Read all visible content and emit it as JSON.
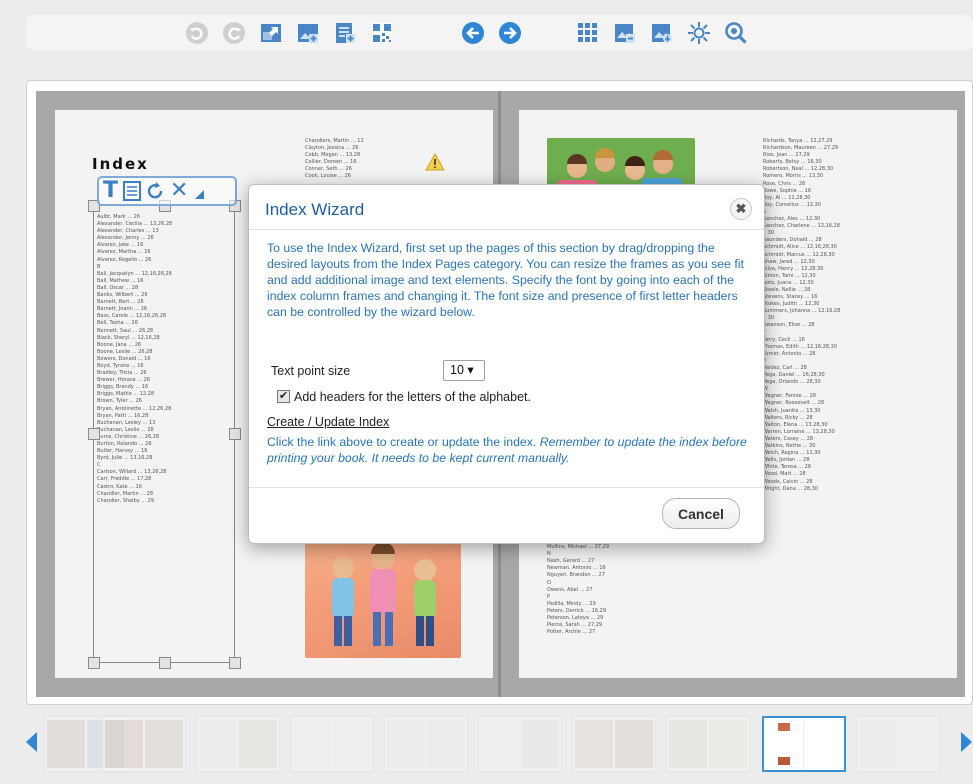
{
  "toolbar": {
    "buttons": [
      {
        "name": "undo-icon",
        "color": "#c8c8c8"
      },
      {
        "name": "redo-icon",
        "color": "#c8c8c8"
      },
      {
        "name": "fullscreen-icon",
        "color": "#4a86c5"
      },
      {
        "name": "add-photo-icon",
        "color": "#4a86c5"
      },
      {
        "name": "add-text-icon",
        "color": "#4a86c5"
      },
      {
        "name": "qr-code-icon",
        "color": "#4a86c5"
      },
      {
        "name": "previous-page-icon",
        "color": "#2e86d6"
      },
      {
        "name": "next-page-icon",
        "color": "#2e86d6"
      },
      {
        "name": "grid-icon",
        "color": "#4a86c5"
      },
      {
        "name": "save-page-icon",
        "color": "#4a86c5"
      },
      {
        "name": "download-page-icon",
        "color": "#4a86c5"
      },
      {
        "name": "brightness-icon",
        "color": "#4a86c5"
      },
      {
        "name": "preview-icon",
        "color": "#4a86c5"
      }
    ]
  },
  "left_page": {
    "title": "Index",
    "col1": "Aulbt, Mark ... 26\nAlexander, Cecilia ... 13,26,28\nAlexander, Charles ... 13\nAlexander, Jenny ... 26\nAlvarez, Jake ... 16\nAlvarez, Martha ... 16\nAlvarez, Rogelio ... 26\nB\nBall, Jacquelyn ... 12,16,26,28\nBall, Mathew ... 16\nBall, Oscar ... 28\nBanks, Wilbert ... 26\nBarnett, Bert ... 26\nBarnett, Joann ... 26\nBass, Carole ... 12,16,26,28\nBell, Tasha ... 26\nBennett, Saul ... 26,28\nBlack, Sheryl ... 12,16,28\nBoone, Jana ... 26\nBoone, Leslie ... 26,28\nBowers, Donald ... 16\nBoyd, Tyrone ... 16\nBradley, Tricia ... 26\nBrewer, Horace ... 26\nBriggs, Brandy ... 16\nBriggs, Mattie ... 12,28\nBrown, Tyler ... 26\nBryan, Antoinette ... 12,26,28\nBryan, Patti ... 16,28\nBuchanan, Lesley ... 13\nBuchanan, Leslie ... 28\nBurns, Christine ... 26,28\nBurton, Rolando ... 26\nButler, Harvey ... 16\nByrd, Julie ... 13,16,28\nC\nCarlson, Willard ... 13,26,28\nCarr, Freddie ... 17,28\nCastro, Kate ... 16\nChandler, Martin ... 28\nChandler, Shelby ... 29",
    "col2": "Chandlers, Martin ... 12\nClayton, Jessica ... 26\nCobb, Megan ... 13,28\nCollier, Doreen ... 16\nConner, Seth ... 26\nCook, Louise ... 26"
  },
  "right_page": {
    "col_left": "Mullins, Irene ... 16\nMullins, Michael ... 27,29\nN\nNash, Gerard ... 27\nNewman, Antonio ... 16\nNguyen, Brandon ... 27\nO\nOwens, Abel ... 27\nP\nPadilla, Mindy ... 29\nPeters, Derrick ... 16,29\nPeterson, Latoya ... 29\nPierce, Sarah ... 27,29\nPotter, Archie ... 27",
    "col_right": "Richards, Tanya ... 12,27,29\nRichardson, Maureen ... 27,29\nRios, Joan ... 27,29\nRoberts, Betsy ... 16,30\nRobertson, Neal ... 12,28,30\nRomero, Morris ... 13,30\nRose, Chris ... 28\nRowe, Sophie ... 16\nRoy, Al ... 12,28,30\nRoy, Cornelius ... 12,30\nS\nSanchez, Alex ... 12,30\nSanchez, Charlene ... 12,16,28\n   30\nSaunders, Donald ... 28\nSchmidt, Alice ... 12,16,28,30\nSchmidt, Marcus ... 12,28,30\nShaw, Jared ... 12,30\nSilva, Henry ... 12,28,30\nSimon, Tami ... 12,30\nSoto, Juana ... 12,30\nSteele, Nellie ... 28\nStevens, Stacey ... 16\nStokes, Judith ... 12,30\nSummers, Johanna ... 12,16,28\n   30\nSwanson, Elise ... 28\nT\nTerry, Cecil ... 16\nThomas, Edith ... 12,16,28,30\nTurner, Antonio ... 28\nV\nValdez, Carl ... 28\nVega, Daniel ... 16,28,30\nVega, Orlando ... 28,30\nW\nWagner, Fannie ... 28\nWagner, Roosevelt ... 28\nWalsh, Juanita ... 13,30\nWalters, Ricky ... 28\nWalton, Elena ... 13,28,30\nWarren, Lorraine ... 13,28,30\nWaters, Casey ... 28\nWatkins, Nettie ... 30\nWelch, Regina ... 12,30\nWells, Jordan ... 28\nWhite, Teresa ... 28\nWood, Matt ... 28\nWoods, Calvin ... 28\nWright, Dana ... 28,30"
  },
  "dialog": {
    "title": "Index Wizard",
    "close_glyph": "✖",
    "intro": "To use the Index Wizard, first set up the pages of this section by drag/dropping the desired layouts from the Index Pages category. You can resize the frames as you see fit and add additional image and text elements. Specify the font by going into each of the index column frames and changing it. The font size and presence of first letter headers can be controlled by the wizard below.",
    "text_point_size_label": "Text point size",
    "text_point_size_value": "10 ▾",
    "headers_checkbox_label": "Add headers for the letters of the alphabet.",
    "headers_checked": true,
    "create_link": "Create / Update Index",
    "help_plain": "Click the link above to create or update the index. ",
    "help_italic": "Remember to update the index before printing your book. It needs to be kept current manually.",
    "cancel": "Cancel"
  },
  "thumbnails": {
    "count": 10,
    "active_index": 8
  }
}
